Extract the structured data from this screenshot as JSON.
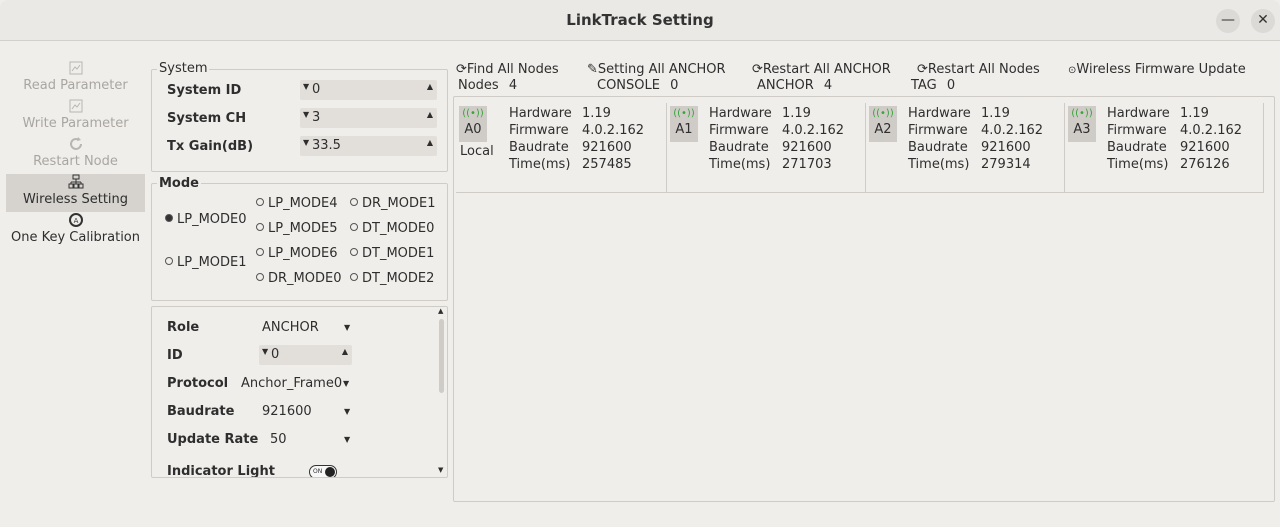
{
  "window": {
    "title": "LinkTrack Setting",
    "minimize_glyph": "—",
    "close_glyph": "✕"
  },
  "sidebar": {
    "items": [
      {
        "label": "Read Parameter",
        "icon": "read-parameter-icon",
        "enabled": false
      },
      {
        "label": "Write Parameter",
        "icon": "write-parameter-icon",
        "enabled": false
      },
      {
        "label": "Restart Node",
        "icon": "restart-icon",
        "enabled": false
      },
      {
        "label": "Wireless Setting",
        "icon": "network-icon",
        "enabled": true,
        "selected": true
      },
      {
        "label": "One Key Calibration",
        "icon": "calibration-icon",
        "enabled": true
      }
    ]
  },
  "system": {
    "group_label": "System",
    "system_id": {
      "label": "System ID",
      "value": "0"
    },
    "system_ch": {
      "label": "System CH",
      "value": "3"
    },
    "tx_gain": {
      "label": "Tx Gain(dB)",
      "value": "33.5"
    }
  },
  "mode": {
    "group_label": "Mode",
    "selected": "LP_MODE0",
    "options": [
      "LP_MODE0",
      "LP_MODE1",
      "LP_MODE4",
      "LP_MODE5",
      "LP_MODE6",
      "DR_MODE0",
      "DR_MODE1",
      "DT_MODE0",
      "DT_MODE1",
      "DT_MODE2"
    ]
  },
  "node_settings": {
    "role": {
      "label": "Role",
      "value": "ANCHOR"
    },
    "id": {
      "label": "ID",
      "value": "0"
    },
    "protocol": {
      "label": "Protocol",
      "value": "Anchor_Frame0"
    },
    "baudrate": {
      "label": "Baudrate",
      "value": "921600"
    },
    "update_rate": {
      "label": "Update Rate",
      "value": "50"
    },
    "indicator_light": {
      "label": "Indicator Light",
      "state": "ON"
    }
  },
  "toolbar": {
    "find_all_nodes": {
      "label": "Find All Nodes",
      "sub_label": "Nodes",
      "sub_value": "4"
    },
    "setting_all_anchor": {
      "label": "Setting All ANCHOR",
      "sub_label": "CONSOLE",
      "sub_value": "0"
    },
    "restart_all_anchor": {
      "label": "Restart All ANCHOR",
      "sub_label": "ANCHOR",
      "sub_value": "4"
    },
    "restart_all_nodes": {
      "label": "Restart All Nodes",
      "sub_label": "TAG",
      "sub_value": "0"
    },
    "wireless_firmware_update": {
      "label": "Wireless Firmware Update"
    }
  },
  "node_fields": {
    "hardware": "Hardware",
    "firmware": "Firmware",
    "baudrate": "Baudrate",
    "time": "Time(ms)"
  },
  "nodes": [
    {
      "id": "A0",
      "local_label": "Local",
      "hardware": "1.19",
      "firmware": "4.0.2.162",
      "baudrate": "921600",
      "time": "257485"
    },
    {
      "id": "A1",
      "hardware": "1.19",
      "firmware": "4.0.2.162",
      "baudrate": "921600",
      "time": "271703"
    },
    {
      "id": "A2",
      "hardware": "1.19",
      "firmware": "4.0.2.162",
      "baudrate": "921600",
      "time": "279314"
    },
    {
      "id": "A3",
      "hardware": "1.19",
      "firmware": "4.0.2.162",
      "baudrate": "921600",
      "time": "276126"
    }
  ],
  "colors": {
    "background": "#f0eeeb",
    "antenna": "#3aa43a",
    "selected_sidebar": "#d6d3cf"
  }
}
